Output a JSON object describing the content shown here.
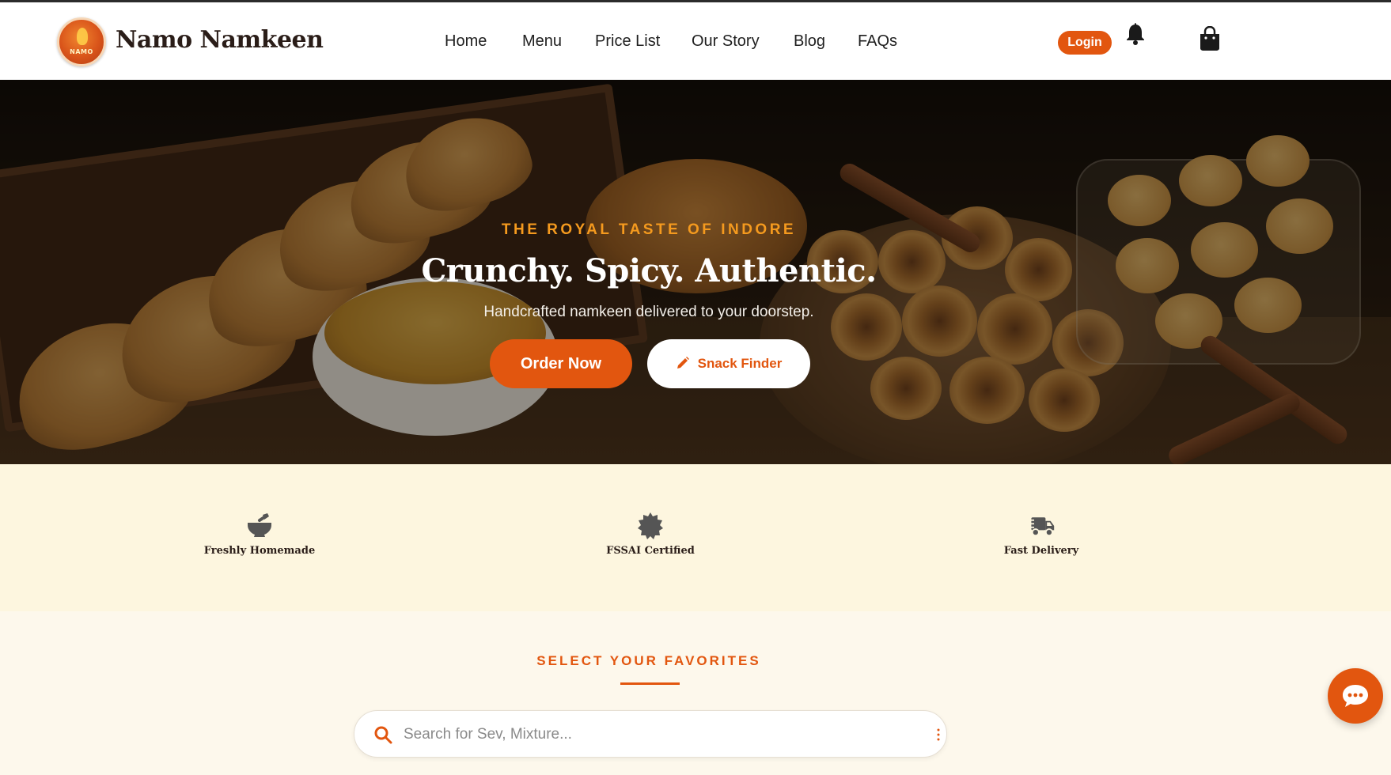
{
  "brand": {
    "name": "Namo Namkeen",
    "logo_text": "NAMO"
  },
  "nav": {
    "items": [
      {
        "label": "Home"
      },
      {
        "label": "Menu"
      },
      {
        "label": "Price List"
      },
      {
        "label": "Our Story"
      },
      {
        "label": "Blog"
      },
      {
        "label": "FAQs"
      }
    ],
    "login_label": "Login",
    "notification_icon": "bell-icon",
    "cart_icon": "shopping-bag-icon"
  },
  "hero": {
    "tagline": "THE ROYAL TASTE OF INDORE",
    "headline": "Crunchy. Spicy. Authentic.",
    "subline": "Handcrafted namkeen delivered to your doorstep.",
    "order_button": "Order Now",
    "finder_button": "Snack Finder",
    "finder_icon": "pencil-icon"
  },
  "features": [
    {
      "label": "Freshly Homemade",
      "icon": "mortar-pestle-icon"
    },
    {
      "label": "FSSAI Certified",
      "icon": "certificate-icon"
    },
    {
      "label": "Fast Delivery",
      "icon": "shipping-fast-icon"
    }
  ],
  "favorites": {
    "title": "SELECT YOUR FAVORITES",
    "search_placeholder": "Search for Sev, Mixture..."
  },
  "chat": {
    "icon": "chat-icon"
  },
  "colors": {
    "accent": "#e2560f",
    "tagline": "#f59a1e",
    "features_bg": "#fdf6df",
    "favorites_bg": "#fdf8ec",
    "text_dark": "#2a1d18"
  }
}
